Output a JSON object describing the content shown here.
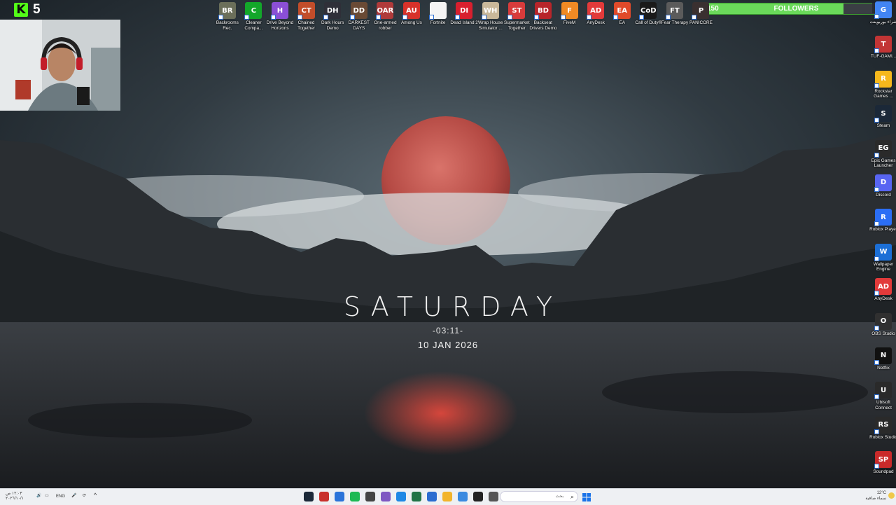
{
  "stream": {
    "kick_logo": "K",
    "viewer_count": "5",
    "followers": {
      "current": "150",
      "label": "FOLLOWERS",
      "goal": "200",
      "progress": 0.75
    }
  },
  "wallpaper": {
    "day": "SATURDAY",
    "time": "-03:11-",
    "date": "10 JAN 2026"
  },
  "top_icons": [
    {
      "label": "Backrooms Rec.",
      "icon": "BR",
      "color": "#6b6f5a"
    },
    {
      "label": "Cleaner Compa...",
      "icon": "C",
      "color": "#13a72a"
    },
    {
      "label": "Drive Beyond Horizons",
      "icon": "H",
      "color": "#8a4fd6"
    },
    {
      "label": "Chained Together",
      "icon": "CT",
      "color": "#c24d2a"
    },
    {
      "label": "Dark Hours Demo",
      "icon": "DH",
      "color": "#2f2f38"
    },
    {
      "label": "DARKEST DAYS",
      "icon": "DD",
      "color": "#6a4a35"
    },
    {
      "label": "One-armed robber",
      "icon": "OAR",
      "color": "#b03a3a"
    },
    {
      "label": "Among Us",
      "icon": "AU",
      "color": "#d8322a"
    },
    {
      "label": "Fortnite",
      "icon": "",
      "color": "#f4f4f4"
    },
    {
      "label": "Dead Island 2",
      "icon": "DI",
      "color": "#d81f2e"
    },
    {
      "label": "Wrap House Simulator ...",
      "icon": "WH",
      "color": "#c9b89a"
    },
    {
      "label": "Supermarket Together",
      "icon": "ST",
      "color": "#d83b3b"
    },
    {
      "label": "Backseat Drivers Demo",
      "icon": "BD",
      "color": "#b8252a"
    },
    {
      "label": "FiveM",
      "icon": "F",
      "color": "#f08a24"
    },
    {
      "label": "AnyDesk",
      "icon": "AD",
      "color": "#e23a3a"
    },
    {
      "label": "EA",
      "icon": "EA",
      "color": "#e04a2a"
    },
    {
      "label": "Call of Duty®",
      "icon": "CoD",
      "color": "#1a1a1a"
    },
    {
      "label": "Fear Therapy",
      "icon": "FT",
      "color": "#5b5b5b"
    },
    {
      "label": "PANICORE",
      "icon": "P",
      "color": "#3a3030"
    }
  ],
  "right_icons": [
    {
      "label": "شراء بوربوينت",
      "icon": "G",
      "color": "#4285f4"
    },
    {
      "label": "TUF-GAMI...",
      "icon": "T",
      "color": "#c23535"
    },
    {
      "label": "Rockstar Games ...",
      "icon": "R",
      "color": "#f6b81c"
    },
    {
      "label": "Steam",
      "icon": "S",
      "color": "#1b2838"
    },
    {
      "label": "Epic Games Launcher",
      "icon": "EG",
      "color": "#2a2a2a"
    },
    {
      "label": "Discord",
      "icon": "D",
      "color": "#5865f2"
    },
    {
      "label": "Roblox Player",
      "icon": "R",
      "color": "#2b6ef5"
    },
    {
      "label": "Wallpaper Engine",
      "icon": "W",
      "color": "#1c6fd6"
    },
    {
      "label": "AnyDesk",
      "icon": "AD",
      "color": "#e23a3a"
    },
    {
      "label": "OBS Studio",
      "icon": "O",
      "color": "#303030"
    },
    {
      "label": "Netflix",
      "icon": "N",
      "color": "#111111"
    },
    {
      "label": "Ubisoft Connect",
      "icon": "U",
      "color": "#2a2a2a"
    },
    {
      "label": "Roblox Studio",
      "icon": "RS",
      "color": "#2a2a2a"
    },
    {
      "label": "Soundpad",
      "icon": "SP",
      "color": "#c92a2a"
    }
  ],
  "right_top_chrome": {
    "label": "Google Chrome"
  },
  "taskbar": {
    "lang": "ENG",
    "tray_time": "١٢:٠٣ ص",
    "tray_date": "٢٠٢٦/١٠/١",
    "search_placeholder": "بحث",
    "weather_temp": "12°C",
    "weather_desc": "سماء صافية",
    "apps": [
      {
        "name": "steam-taskbar-icon",
        "color": "#1b2838"
      },
      {
        "name": "app-red-icon",
        "color": "#c9302c"
      },
      {
        "name": "app-blue-icon",
        "color": "#2a73d9"
      },
      {
        "name": "spotify-icon",
        "color": "#1db954"
      },
      {
        "name": "obs-icon",
        "color": "#444444"
      },
      {
        "name": "chat-icon",
        "color": "#7e57c2"
      },
      {
        "name": "edge-icon",
        "color": "#1e88e5"
      },
      {
        "name": "excel-icon",
        "color": "#217346"
      },
      {
        "name": "calendar-icon",
        "color": "#2b6cd0"
      },
      {
        "name": "explorer-icon",
        "color": "#f2b42b"
      },
      {
        "name": "photos-icon",
        "color": "#3a8ae0"
      },
      {
        "name": "epic-icon",
        "color": "#222222"
      },
      {
        "name": "notepad-icon",
        "color": "#555555"
      }
    ]
  }
}
